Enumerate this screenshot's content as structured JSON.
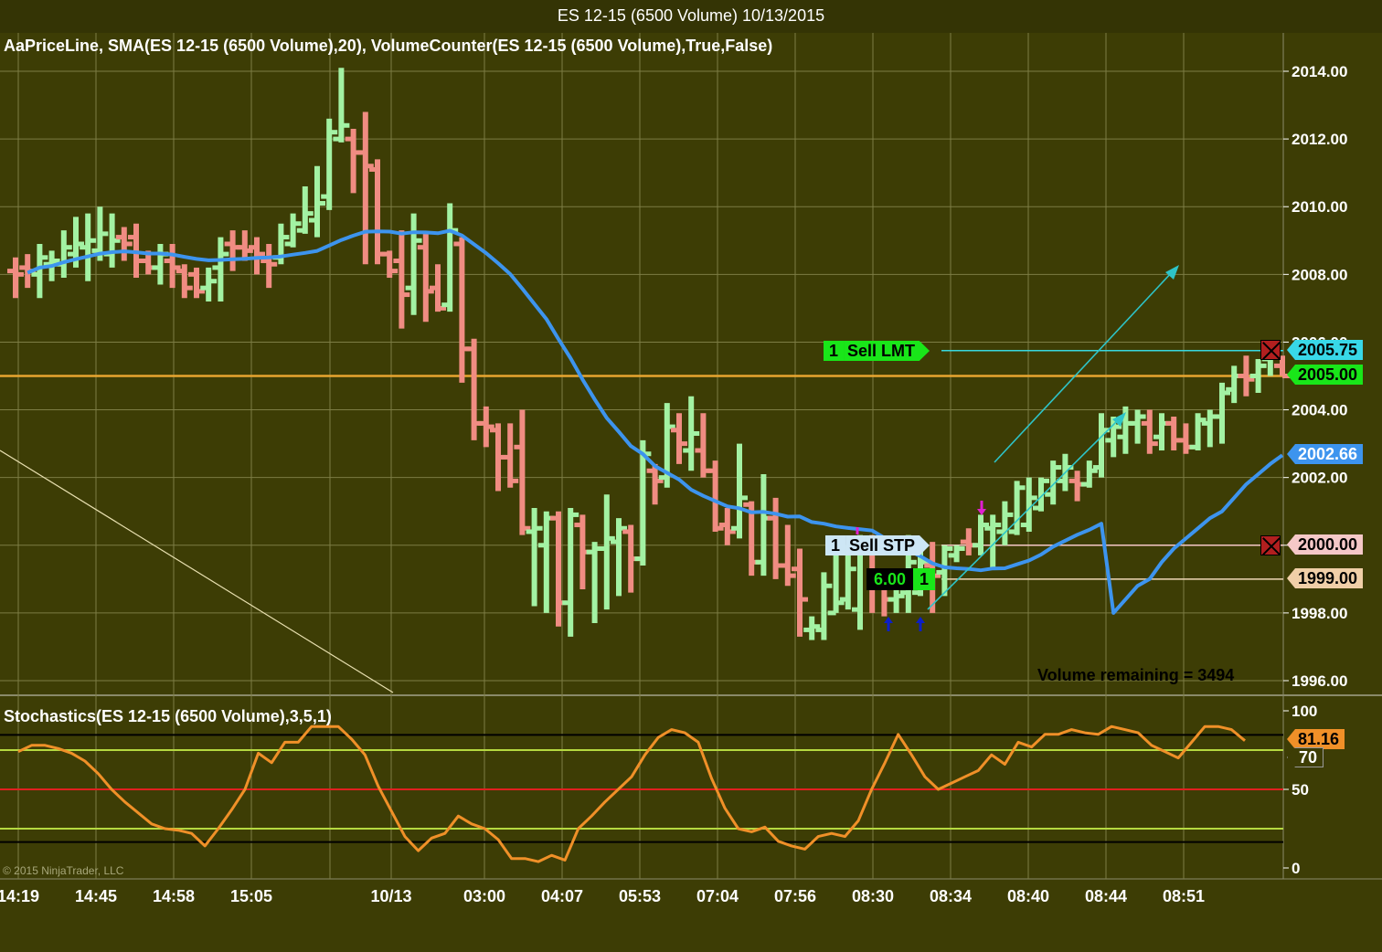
{
  "window": {
    "title": "ES 12-15 (6500 Volume)  10/13/2015"
  },
  "panels": {
    "price_label": "AaPriceLine,  SMA(ES 12-15 (6500 Volume),20),  VolumeCounter(ES 12-15 (6500 Volume),True,False)",
    "stoch_label": "Stochastics(ES 12-15 (6500 Volume),3,5,1)",
    "volume_remaining": "Volume remaining = 3494",
    "copyright": "© 2015 NinjaTrader, LLC"
  },
  "orders": {
    "sell_limit": {
      "qty": "1",
      "label": "Sell LMT",
      "price_badge": "2005.75"
    },
    "sell_stop": {
      "qty": "1",
      "label": "Sell STP",
      "price_badge": "2000.00"
    },
    "position": {
      "pnl": "6.00",
      "qty": "1",
      "entry_badge": "1999.00"
    },
    "last_price_badge": "2005.00",
    "sma_badge": "2002.66",
    "stoch_badge": "81.16",
    "stoch_level_badge": "70"
  },
  "colors": {
    "background": "#3d3d05",
    "up_bar": "#a3f2a3",
    "down_bar": "#f08c82",
    "sma": "#3d94ee",
    "last_price_line": "#e8a530",
    "stoch_line": "#f09028",
    "limit_line": "#38d8e0",
    "stop_line": "#f5c8c8",
    "entry_line": "#f0d8b8"
  },
  "chart_data": [
    {
      "type": "bar",
      "subtype": "ohlc",
      "ylim": [
        1995.6,
        2014.8
      ],
      "y_ticks": [
        1996,
        1998,
        2000,
        2002,
        2004,
        2006,
        2008,
        2010,
        2012,
        2014
      ],
      "x_tick_labels": [
        "14:19",
        "14:45",
        "14:58",
        "15:05",
        "10/13",
        "03:00",
        "04:07",
        "05:53",
        "07:04",
        "07:56",
        "08:30",
        "08:34",
        "08:40",
        "08:44",
        "08:51"
      ],
      "bars": [
        [
          2008.1,
          2008.5,
          2007.3,
          2008.0
        ],
        [
          2008.2,
          2008.6,
          2007.6,
          2008.1
        ],
        [
          2008.0,
          2008.9,
          2007.3,
          2008.5
        ],
        [
          2008.3,
          2008.7,
          2007.8,
          2008.4
        ],
        [
          2008.3,
          2009.3,
          2007.9,
          2008.8
        ],
        [
          2008.6,
          2009.7,
          2008.2,
          2008.9
        ],
        [
          2008.8,
          2009.8,
          2007.8,
          2009.0
        ],
        [
          2008.7,
          2010.0,
          2008.4,
          2009.2
        ],
        [
          2008.6,
          2009.8,
          2008.2,
          2009.0
        ],
        [
          2009.1,
          2009.4,
          2008.4,
          2008.9
        ],
        [
          2009.1,
          2009.5,
          2007.9,
          2008.4
        ],
        [
          2008.4,
          2008.7,
          2008.0,
          2008.2
        ],
        [
          2008.2,
          2008.9,
          2007.7,
          2008.6
        ],
        [
          2008.4,
          2008.9,
          2007.6,
          2008.2
        ],
        [
          2008.1,
          2008.3,
          2007.3,
          2007.6
        ],
        [
          2008.0,
          2008.2,
          2007.3,
          2007.5
        ],
        [
          2007.6,
          2008.2,
          2007.2,
          2007.8
        ],
        [
          2008.2,
          2009.1,
          2007.2,
          2008.6
        ],
        [
          2008.9,
          2009.3,
          2008.1,
          2008.8
        ],
        [
          2008.8,
          2009.3,
          2008.4,
          2008.7
        ],
        [
          2008.8,
          2009.1,
          2008.0,
          2008.6
        ],
        [
          2008.4,
          2008.9,
          2007.6,
          2008.3
        ],
        [
          2008.5,
          2009.5,
          2008.3,
          2009.1
        ],
        [
          2008.9,
          2009.8,
          2008.8,
          2009.5
        ],
        [
          2009.3,
          2010.6,
          2009.2,
          2009.8
        ],
        [
          2009.6,
          2011.2,
          2009.1,
          2010.1
        ],
        [
          2010.3,
          2012.6,
          2009.9,
          2012.2
        ],
        [
          2012.0,
          2014.1,
          2011.9,
          2012.4
        ],
        [
          2012.0,
          2012.3,
          2010.4,
          2011.6
        ],
        [
          2011.6,
          2012.8,
          2008.3,
          2011.2
        ],
        [
          2011.1,
          2011.4,
          2008.3,
          2008.6
        ],
        [
          2008.6,
          2008.7,
          2007.9,
          2008.1
        ],
        [
          2008.4,
          2009.3,
          2006.4,
          2007.4
        ],
        [
          2007.6,
          2009.8,
          2006.8,
          2009.0
        ],
        [
          2008.8,
          2009.2,
          2006.6,
          2007.5
        ],
        [
          2007.6,
          2008.3,
          2006.9,
          2007.0
        ],
        [
          2007.1,
          2010.1,
          2006.9,
          2009.3
        ],
        [
          2008.9,
          2009.1,
          2004.8,
          2005.8
        ],
        [
          2005.8,
          2006.1,
          2003.1,
          2003.6
        ],
        [
          2003.6,
          2004.1,
          2002.9,
          2003.5
        ],
        [
          2003.4,
          2003.6,
          2001.6,
          2002.6
        ],
        [
          2002.6,
          2003.6,
          2001.7,
          2001.9
        ],
        [
          2002.9,
          2004.0,
          2000.3,
          2000.5
        ],
        [
          2000.4,
          2001.1,
          1998.2,
          2000.5
        ],
        [
          2000.0,
          2001.0,
          1998.0,
          2000.8
        ],
        [
          2000.8,
          2001.0,
          1997.6,
          1998.3
        ],
        [
          1998.3,
          2001.1,
          1997.3,
          2000.9
        ],
        [
          2000.6,
          2000.9,
          1998.7,
          1999.8
        ],
        [
          1999.8,
          2000.1,
          1997.7,
          1999.9
        ],
        [
          1999.9,
          2001.5,
          1998.1,
          2000.2
        ],
        [
          2000.1,
          2000.8,
          1998.5,
          2000.5
        ],
        [
          2000.4,
          2000.6,
          1998.6,
          1999.6
        ],
        [
          1999.6,
          2003.1,
          1999.4,
          2002.7
        ],
        [
          2002.2,
          2002.4,
          2001.2,
          2001.9
        ],
        [
          2002.0,
          2004.2,
          2001.7,
          2003.5
        ],
        [
          2003.4,
          2003.9,
          2002.4,
          2003.0
        ],
        [
          2002.8,
          2004.4,
          2002.2,
          2003.3
        ],
        [
          2002.8,
          2003.9,
          2002.0,
          2002.2
        ],
        [
          2002.2,
          2002.5,
          2000.4,
          2000.5
        ],
        [
          2000.6,
          2001.1,
          2000.0,
          2000.4
        ],
        [
          2000.5,
          2003.0,
          2000.2,
          2001.4
        ],
        [
          2001.2,
          2001.3,
          1999.1,
          1999.5
        ],
        [
          1999.5,
          2002.1,
          1999.1,
          2000.8
        ],
        [
          2000.8,
          2001.4,
          1999.0,
          1999.4
        ],
        [
          1999.4,
          2000.6,
          1998.8,
          1999.1
        ],
        [
          1999.3,
          1999.9,
          1997.3,
          1998.4
        ],
        [
          1997.5,
          1997.9,
          1997.2,
          1997.6
        ],
        [
          1997.5,
          1999.2,
          1997.2,
          1998.8
        ],
        [
          1998.0,
          1999.8,
          1998.0,
          1998.3
        ],
        [
          1998.4,
          2000.0,
          1998.1,
          1999.3
        ],
        [
          1998.1,
          2000.3,
          1997.5,
          1999.8
        ],
        [
          2000.0,
          2000.3,
          1998.0,
          1998.8
        ],
        [
          1998.8,
          1999.1,
          1997.9,
          1998.4
        ],
        [
          1998.4,
          1998.8,
          1998.0,
          1998.5
        ],
        [
          1998.6,
          2000.3,
          1998.0,
          1999.5
        ],
        [
          1998.6,
          1999.9,
          1998.5,
          1999.5
        ],
        [
          1999.4,
          2000.1,
          1998.0,
          1999.1
        ],
        [
          1999.2,
          2000.0,
          1998.5,
          1999.9
        ],
        [
          1999.7,
          2000.0,
          1999.5,
          1999.9
        ],
        [
          2000.1,
          2000.5,
          1999.7,
          2000.0
        ],
        [
          2000.0,
          2000.9,
          1999.7,
          2000.6
        ],
        [
          2000.5,
          2000.9,
          1999.3,
          2000.6
        ],
        [
          2000.4,
          2001.3,
          2000.0,
          2000.9
        ],
        [
          2000.4,
          2001.9,
          2000.3,
          2001.7
        ],
        [
          2000.6,
          2002.0,
          2000.4,
          2001.4
        ],
        [
          2001.1,
          2002.0,
          2001.0,
          2001.9
        ],
        [
          2001.5,
          2002.5,
          2001.2,
          2002.3
        ],
        [
          2001.9,
          2002.7,
          2001.6,
          2002.3
        ],
        [
          2001.9,
          2002.2,
          2001.3,
          2001.8
        ],
        [
          2001.8,
          2002.5,
          2001.7,
          2002.2
        ],
        [
          2002.3,
          2003.9,
          2002.0,
          2003.4
        ],
        [
          2003.1,
          2003.8,
          2002.6,
          2003.5
        ],
        [
          2003.2,
          2004.1,
          2002.7,
          2003.6
        ],
        [
          2003.6,
          2004.0,
          2003.0,
          2003.8
        ],
        [
          2003.6,
          2004.0,
          2002.7,
          2003.0
        ],
        [
          2003.2,
          2003.9,
          2002.8,
          2003.6
        ],
        [
          2003.6,
          2003.8,
          2002.8,
          2003.1
        ],
        [
          2003.1,
          2003.6,
          2002.7,
          2002.9
        ],
        [
          2002.9,
          2003.9,
          2002.8,
          2003.7
        ],
        [
          2003.6,
          2004.0,
          2002.9,
          2003.8
        ],
        [
          2003.8,
          2004.8,
          2003.0,
          2004.5
        ],
        [
          2004.6,
          2005.3,
          2004.2,
          2005.0
        ],
        [
          2005.0,
          2005.6,
          2004.4,
          2004.9
        ],
        [
          2005.0,
          2005.5,
          2004.5,
          2005.3
        ],
        [
          2005.5,
          2005.8,
          2005.0,
          2005.6
        ],
        [
          2005.3,
          2005.6,
          2005.0,
          2005.0
        ]
      ],
      "sma20": [
        1998.0,
        1998.4,
        1998.8,
        1999.0,
        1999.5,
        1999.9,
        2000.2,
        2000.5,
        2000.8,
        2001.0,
        2001.4,
        2001.8,
        2002.1,
        2002.4,
        2002.66
      ],
      "horizontal_lines": {
        "sell_limit": 2005.75,
        "last_price": 2005.0,
        "sell_stop": 2000.0,
        "entry": 1999.0
      }
    },
    {
      "type": "line",
      "title": "Stochastics(ES 12-15 (6500 Volume),3,5,1)",
      "ylim": [
        0,
        100
      ],
      "y_ticks": [
        0,
        50,
        100
      ],
      "levels": [
        20,
        25,
        50,
        75,
        80
      ],
      "values": [
        74,
        78,
        78,
        76,
        73,
        68,
        60,
        50,
        42,
        35,
        28,
        25,
        24,
        22,
        14,
        25,
        37,
        50,
        73,
        67,
        80,
        80,
        90,
        90,
        90,
        82,
        72,
        52,
        36,
        20,
        11,
        19,
        22,
        33,
        28,
        25,
        18,
        6,
        6,
        4,
        8,
        5,
        25,
        33,
        42,
        50,
        58,
        72,
        83,
        88,
        86,
        80,
        57,
        38,
        25,
        23,
        26,
        17,
        14,
        12,
        20,
        22,
        20,
        30,
        50,
        67,
        85,
        72,
        58,
        50,
        54,
        58,
        62,
        72,
        66,
        80,
        77,
        85,
        85,
        88,
        86,
        85,
        90,
        88,
        86,
        78,
        74,
        70,
        80,
        90,
        90,
        88,
        81
      ]
    }
  ]
}
